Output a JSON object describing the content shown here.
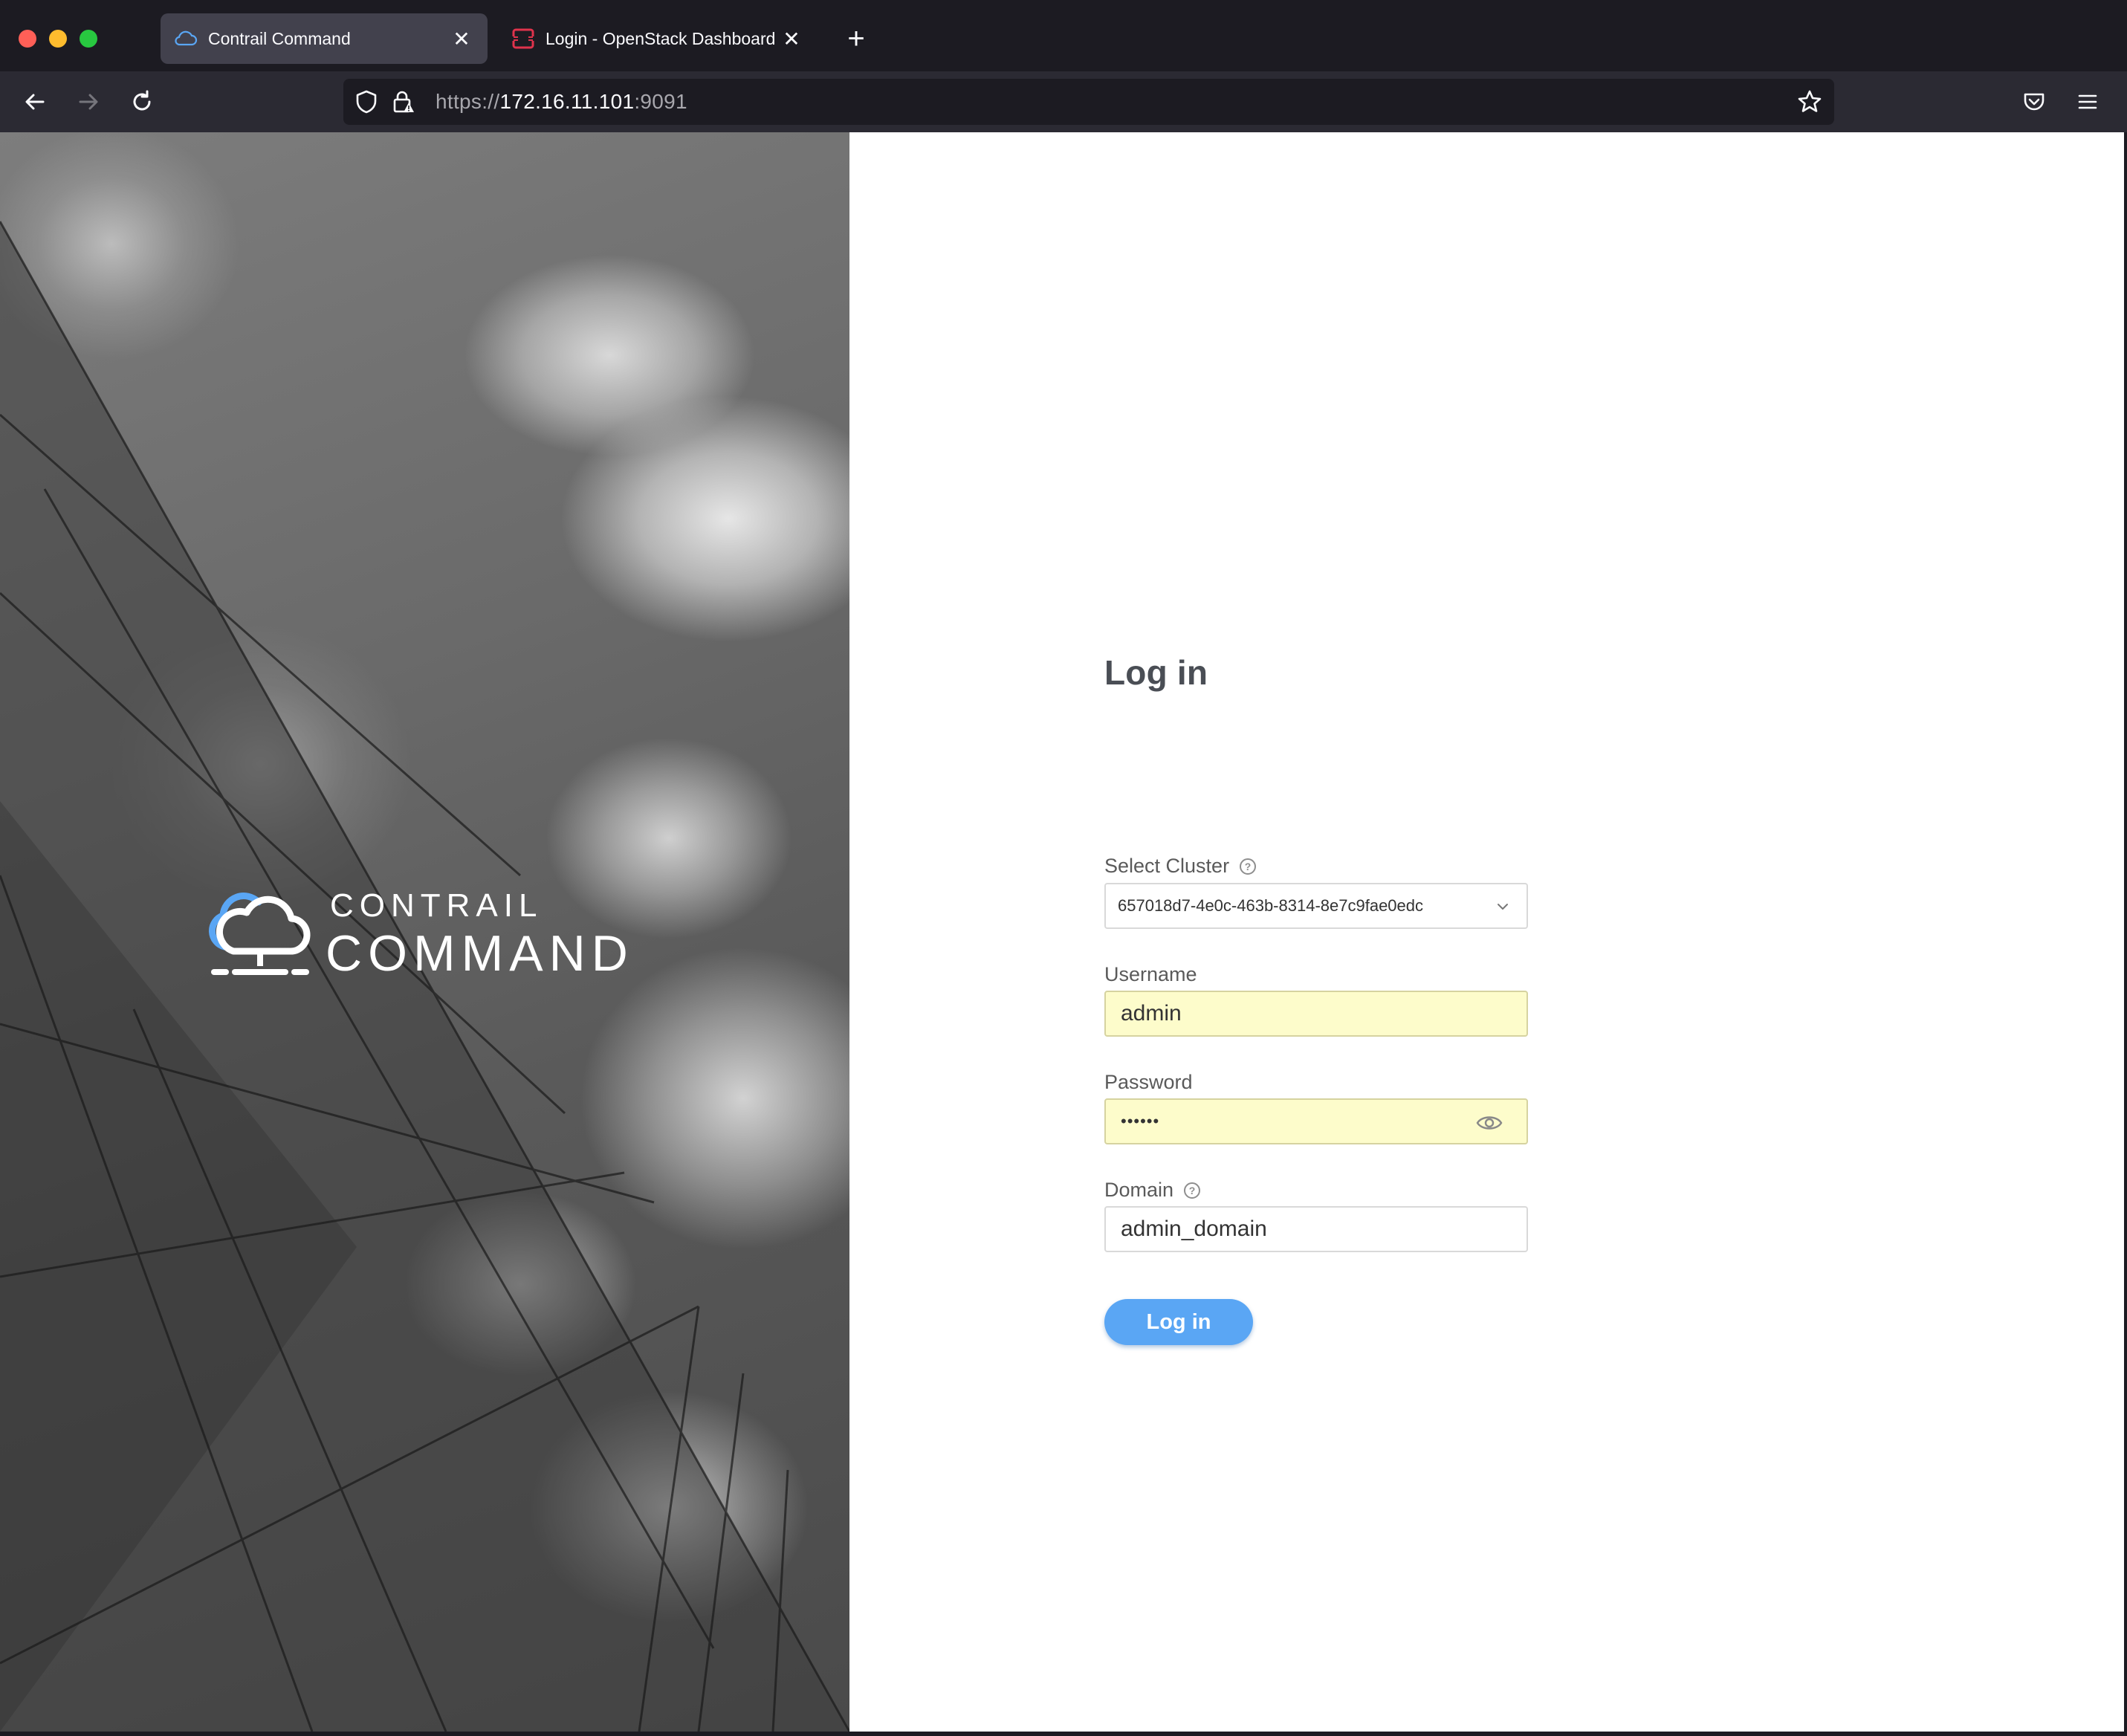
{
  "browser": {
    "tabs": [
      {
        "title": "Contrail Command",
        "active": true,
        "icon": "cloud-icon"
      },
      {
        "title": "Login - OpenStack Dashboard",
        "active": false,
        "icon": "openstack-icon"
      }
    ],
    "url": {
      "scheme": "https://",
      "host": "172.16.11.101",
      "port": ":9091"
    }
  },
  "brand": {
    "line1": "CONTRAIL",
    "line2": "COMMAND",
    "accent_color": "#5aa6f4"
  },
  "login": {
    "heading": "Log in",
    "cluster_label": "Select Cluster",
    "cluster_value": "657018d7-4e0c-463b-8314-8e7c9fae0edc",
    "username_label": "Username",
    "username_value": "admin",
    "password_label": "Password",
    "password_value": "••••••",
    "domain_label": "Domain",
    "domain_value": "admin_domain",
    "submit_label": "Log in"
  }
}
